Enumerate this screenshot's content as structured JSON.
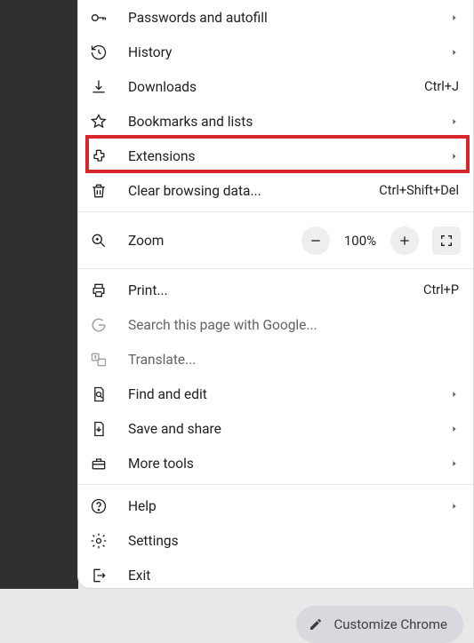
{
  "menu": {
    "sections": [
      {
        "items": [
          {
            "id": "passwords-and-autofill",
            "icon": "key-icon",
            "label": "Passwords and autofill",
            "submenu": true
          },
          {
            "id": "history",
            "icon": "history-icon",
            "label": "History",
            "submenu": true
          },
          {
            "id": "downloads",
            "icon": "download-icon",
            "label": "Downloads",
            "shortcut": "Ctrl+J"
          },
          {
            "id": "bookmarks-and-lists",
            "icon": "star-icon",
            "label": "Bookmarks and lists",
            "submenu": true
          },
          {
            "id": "extensions",
            "icon": "puzzle-icon",
            "label": "Extensions",
            "submenu": true,
            "highlight": true
          },
          {
            "id": "clear-browsing-data",
            "icon": "trash-icon",
            "label": "Clear browsing data...",
            "shortcut": "Ctrl+Shift+Del"
          }
        ]
      },
      {
        "zoom": {
          "label": "Zoom",
          "value": "100%"
        }
      },
      {
        "items": [
          {
            "id": "print",
            "icon": "print-icon",
            "label": "Print...",
            "shortcut": "Ctrl+P"
          },
          {
            "id": "search-this-page",
            "icon": "google-icon",
            "label": "Search this page with Google...",
            "gray": true
          },
          {
            "id": "translate",
            "icon": "translate-icon",
            "label": "Translate...",
            "gray": true
          },
          {
            "id": "find-and-edit",
            "icon": "find-page-icon",
            "label": "Find and edit",
            "submenu": true
          },
          {
            "id": "save-and-share",
            "icon": "file-out-icon",
            "label": "Save and share",
            "submenu": true
          },
          {
            "id": "more-tools",
            "icon": "toolbox-icon",
            "label": "More tools",
            "submenu": true
          }
        ]
      },
      {
        "items": [
          {
            "id": "help",
            "icon": "help-icon",
            "label": "Help",
            "submenu": true
          },
          {
            "id": "settings",
            "icon": "gear-icon",
            "label": "Settings"
          },
          {
            "id": "exit",
            "icon": "exit-icon",
            "label": "Exit"
          }
        ]
      }
    ]
  },
  "customize": {
    "label": "Customize Chrome"
  }
}
